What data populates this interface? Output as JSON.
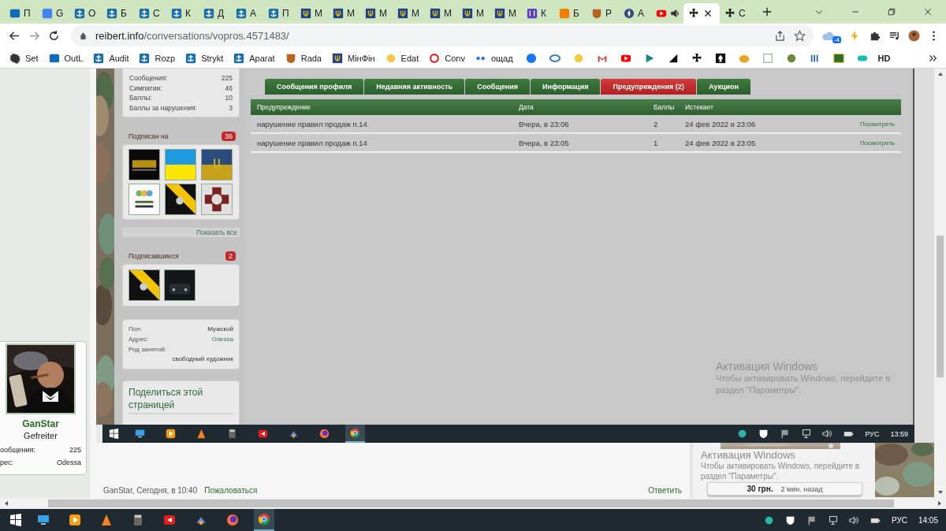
{
  "browser": {
    "tabs": [
      {
        "label": "П",
        "selected": false,
        "audio": false
      },
      {
        "label": "G",
        "selected": false,
        "audio": false
      },
      {
        "label": "О",
        "selected": false,
        "audio": false
      },
      {
        "label": "Б",
        "selected": false,
        "audio": false
      },
      {
        "label": "С",
        "selected": false,
        "audio": false
      },
      {
        "label": "К",
        "selected": false,
        "audio": false
      },
      {
        "label": "Д",
        "selected": false,
        "audio": false
      },
      {
        "label": "А",
        "selected": false,
        "audio": false
      },
      {
        "label": "П",
        "selected": false,
        "audio": false
      },
      {
        "label": "М",
        "selected": false,
        "audio": false
      },
      {
        "label": "М",
        "selected": false,
        "audio": false
      },
      {
        "label": "М",
        "selected": false,
        "audio": false
      },
      {
        "label": "М",
        "selected": false,
        "audio": false
      },
      {
        "label": "М",
        "selected": false,
        "audio": false
      },
      {
        "label": "М",
        "selected": false,
        "audio": false
      },
      {
        "label": "М",
        "selected": false,
        "audio": false
      },
      {
        "label": "К",
        "selected": false,
        "audio": false
      },
      {
        "label": "Б",
        "selected": false,
        "audio": false
      },
      {
        "label": "Р",
        "selected": false,
        "audio": false
      },
      {
        "label": "А",
        "selected": false,
        "audio": false
      },
      {
        "selected": false,
        "audio": true
      },
      {
        "selected": true,
        "audio": false
      },
      {
        "label": "С",
        "selected": false,
        "audio": false
      }
    ],
    "address": {
      "host": "reibert.info",
      "path": "/conversations/vopros.4571483/"
    },
    "weather_badge": "-4",
    "bookmarks": [
      "Set",
      "OutL",
      "Audit",
      "Rozp",
      "Strykt",
      "Aparat",
      "Rada",
      "МінФін",
      "Edat",
      "Conv",
      "ощад"
    ],
    "bookmarks_after_icons": [
      "HD"
    ]
  },
  "screenshot": {
    "stats": [
      {
        "label": "Сообщения:",
        "value": "225"
      },
      {
        "label": "Симпатии:",
        "value": "46"
      },
      {
        "label": "Баллы:",
        "value": "10"
      },
      {
        "label": "Баллы за нарушения:",
        "value": "3"
      }
    ],
    "following": {
      "title": "Подписан на",
      "count": "36",
      "show_all": "Показать все"
    },
    "followers": {
      "title": "Подписавшиеся",
      "count": "2"
    },
    "info": [
      {
        "label": "Пол:",
        "value": "Мужской",
        "link": false,
        "kind": "inline"
      },
      {
        "label": "Адрес:",
        "value": "Odessa",
        "link": true,
        "kind": "inline"
      },
      {
        "label": "Род занятий:",
        "value": "свободный художник",
        "link": false,
        "kind": "stacked"
      }
    ],
    "share_title": "Поделиться этой страницей",
    "tabs": [
      {
        "label": "Сообщения профиля",
        "selected": false
      },
      {
        "label": "Недавняя активность",
        "selected": false
      },
      {
        "label": "Сообщения",
        "selected": false
      },
      {
        "label": "Информация",
        "selected": false
      },
      {
        "label": "Предупреждения (2)",
        "selected": true
      },
      {
        "label": "Аукцион",
        "selected": false
      }
    ],
    "table": {
      "columns": [
        "Предупреждение",
        "Дата",
        "Баллы",
        "Истекает"
      ],
      "rows": [
        {
          "cells": [
            "нарушение правил продаж п.14",
            "Вчера, в 23:06",
            "2",
            "24 фев 2022 в 23:06"
          ],
          "action": "Посмотреть"
        },
        {
          "cells": [
            "нарушение правил продаж п.14",
            "Вчера, в 23:05",
            "1",
            "24 фев 2022 в 23:05"
          ],
          "action": "Посмотреть"
        }
      ]
    },
    "watermark": {
      "title": "Активация Windows",
      "text": "Чтобы активировать Windows, перейдите в раздел \"Параметры\"."
    },
    "taskbar": {
      "apps": [
        {
          "selected": false
        },
        {
          "selected": false
        },
        {
          "selected": false
        },
        {
          "selected": false
        },
        {
          "selected": false
        },
        {
          "selected": false
        },
        {
          "selected": false
        },
        {
          "selected": true
        }
      ],
      "lang": "РУС",
      "time": "13:59"
    }
  },
  "author": {
    "name": "GanStar",
    "rank": "Gefreiter",
    "stats": [
      {
        "label": "ообщения:",
        "value": "225"
      },
      {
        "label": "рес:",
        "value": "Odessa"
      }
    ]
  },
  "post_footer": {
    "meta": "GanStar, Сегодня, в 10:40",
    "report": "Пожаловаться",
    "reply": "Ответить"
  },
  "sidebar_card": {
    "price": "30 грн.",
    "time": "2 мин. назад"
  },
  "watermark": {
    "title": "Активация Windows",
    "line1": "Чтобы активировать Windows, перейдите в",
    "line2": "раздел \"Параметры\"."
  },
  "taskbar": {
    "apps": [
      {
        "selected": false
      },
      {
        "selected": false
      },
      {
        "selected": false
      },
      {
        "selected": false
      },
      {
        "selected": false
      },
      {
        "selected": false
      },
      {
        "selected": false
      },
      {
        "selected": true
      }
    ],
    "lang": "РУС",
    "time": "14:05"
  }
}
